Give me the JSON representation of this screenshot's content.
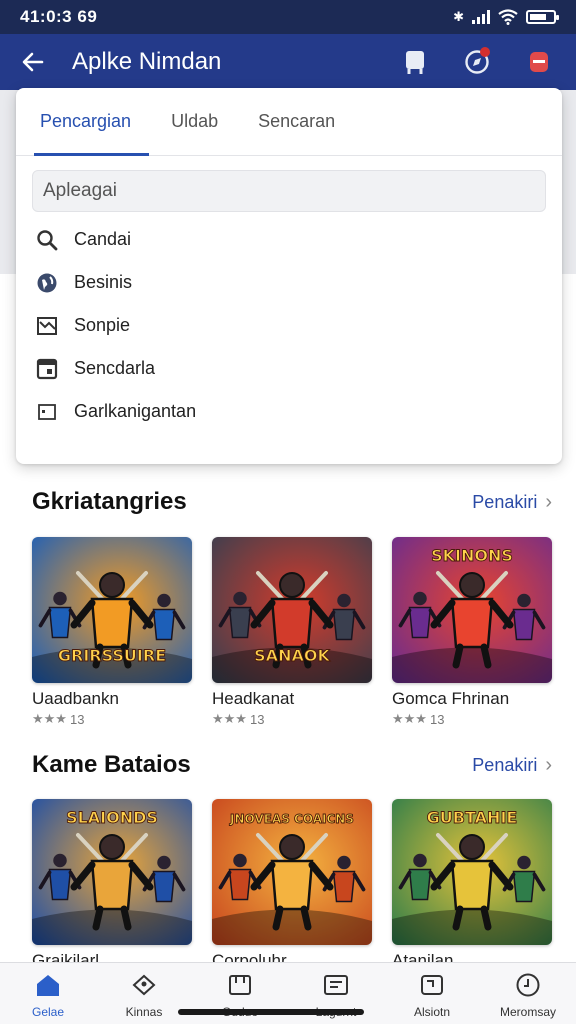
{
  "status_bar": {
    "time": "41:0:3 69"
  },
  "app_bar": {
    "title": "Aplke Nimdan"
  },
  "tabs": [
    {
      "label": "Pencargian",
      "active": true
    },
    {
      "label": "Uldab",
      "active": false
    },
    {
      "label": "Sencaran",
      "active": false
    }
  ],
  "search": {
    "placeholder": "Apleagai"
  },
  "menu_items": [
    {
      "label": "Candai",
      "icon": "search-icon"
    },
    {
      "label": "Besinis",
      "icon": "globe-icon"
    },
    {
      "label": "Sonpie",
      "icon": "map-icon"
    },
    {
      "label": "Sencdarla",
      "icon": "calendar-icon"
    },
    {
      "label": "Garlkanigantan",
      "icon": "window-icon"
    }
  ],
  "sections": [
    {
      "title": "Gkriatangries",
      "more_label": "Penakiri",
      "cards": [
        {
          "name": "Uaadbankn",
          "rating": "13",
          "thumb_text": "GRIRSSUIRE",
          "colors": [
            "#1d5fb8",
            "#f29b24"
          ]
        },
        {
          "name": "Headkanat",
          "rating": "13",
          "thumb_text": "SANAOK",
          "colors": [
            "#3a3f4f",
            "#d23b2b"
          ]
        },
        {
          "name": "Gomca Fhrinan",
          "rating": "13",
          "thumb_text": "SKINONS",
          "colors": [
            "#6a2c8f",
            "#e8442f"
          ]
        }
      ]
    },
    {
      "title": "Kame Bataios",
      "more_label": "Penakiri",
      "cards": [
        {
          "name": "Graikilarl",
          "rating": "",
          "thumb_text": "SLAIONDS",
          "colors": [
            "#1f4fa6",
            "#e9a53a"
          ]
        },
        {
          "name": "Corpoluhr",
          "rating": "",
          "thumb_text": "JNOVEAS COAICNS",
          "colors": [
            "#c8461e",
            "#f4b340"
          ]
        },
        {
          "name": "Atanilan",
          "rating": "",
          "thumb_text": "GUBTAHIE",
          "colors": [
            "#2f7d4a",
            "#e6c33a"
          ]
        }
      ]
    }
  ],
  "bottom_nav": [
    {
      "label": "Gelae",
      "icon": "home-icon",
      "active": true
    },
    {
      "label": "Kinnas",
      "icon": "tag-icon",
      "active": false
    },
    {
      "label": "Guduo",
      "icon": "apps-icon",
      "active": false
    },
    {
      "label": "Lagurnt",
      "icon": "note-icon",
      "active": false
    },
    {
      "label": "Alsiotn",
      "icon": "puzzle-icon",
      "active": false
    },
    {
      "label": "Meromsay",
      "icon": "clock-icon",
      "active": false
    }
  ]
}
